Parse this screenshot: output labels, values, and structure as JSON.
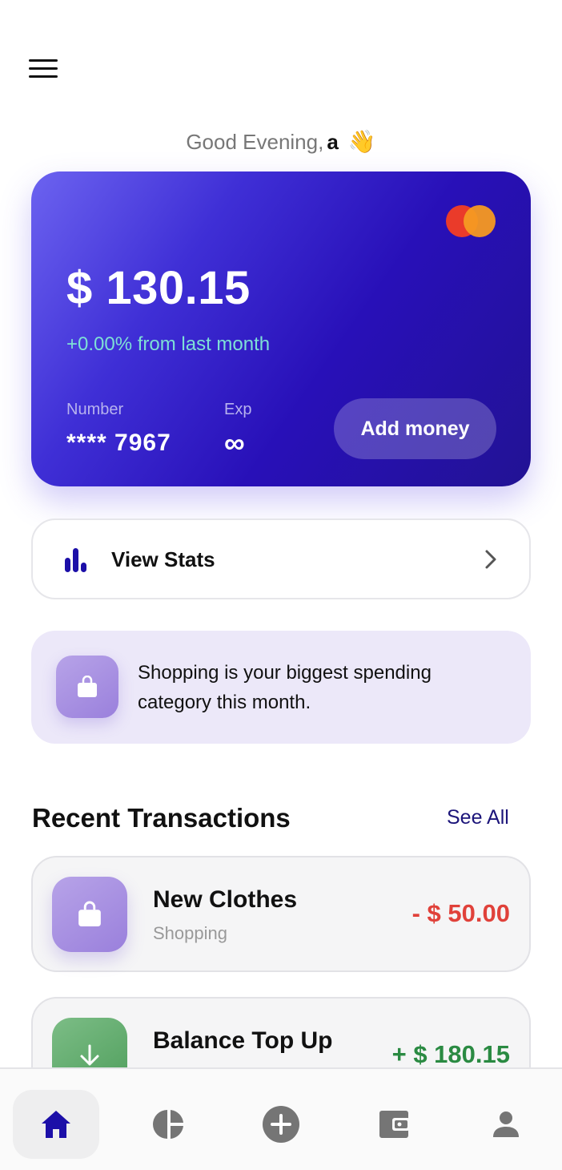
{
  "header": {
    "greeting": "Good Evening,",
    "user_name": "a",
    "wave_emoji": "👋",
    "menu_icon": "hamburger-menu-icon"
  },
  "card": {
    "balance": "$ 130.15",
    "change_text": "+0.00% from last month",
    "number_label": "Number",
    "number_value": "**** 7967",
    "exp_label": "Exp",
    "exp_value": "∞",
    "add_money_label": "Add money",
    "brand_icon": "mastercard-logo",
    "colors": {
      "gradient_start": "#6c63f0",
      "gradient_end": "#221294",
      "change_text": "#7ee0d6"
    }
  },
  "stats": {
    "label": "View Stats",
    "icon": "bar-chart-icon",
    "chevron": "chevron-right-icon"
  },
  "insight": {
    "text": "Shopping is your biggest spending category this month.",
    "icon": "shopping-bag-icon"
  },
  "transactions": {
    "title": "Recent Transactions",
    "see_all_label": "See All",
    "items": [
      {
        "title": "New Clothes",
        "category": "Shopping",
        "amount": "- $ 50.00",
        "icon": "shopping-bag-icon",
        "color": "#e0413a"
      },
      {
        "title": "Balance Top Up",
        "category": "",
        "amount": "+ $ 180.15",
        "icon": "arrow-down-icon",
        "color": "#2a8a42"
      }
    ]
  },
  "bottom_nav": {
    "items": [
      {
        "icon": "home-icon",
        "active": true
      },
      {
        "icon": "pie-chart-icon",
        "active": false
      },
      {
        "icon": "add-circle-icon",
        "active": false
      },
      {
        "icon": "wallet-icon",
        "active": false
      },
      {
        "icon": "profile-icon",
        "active": false
      }
    ],
    "colors": {
      "active": "#1c0fa8",
      "inactive": "#757575"
    }
  }
}
